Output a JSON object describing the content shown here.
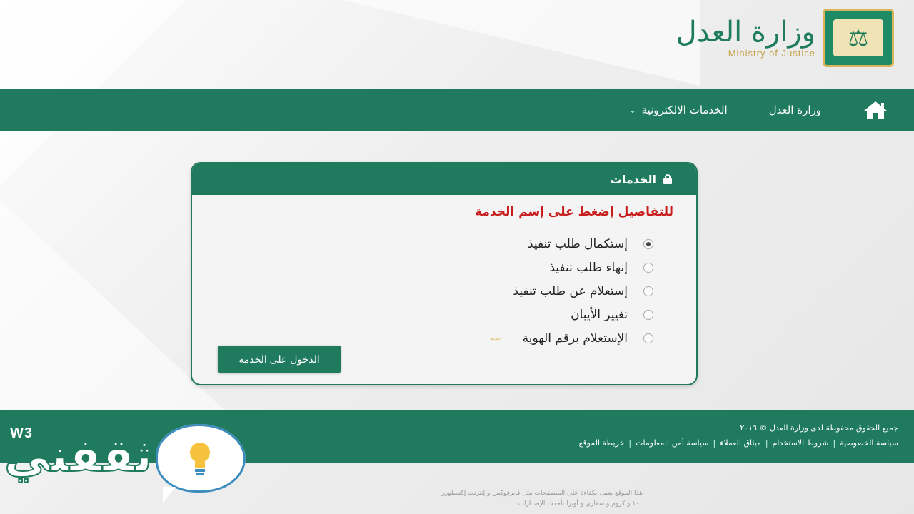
{
  "logo": {
    "arabic": "وزارة العدل",
    "english": "Ministry of Justice"
  },
  "nav": {
    "items": [
      {
        "label": "الخدمات الالكترونية",
        "has_dropdown": true
      },
      {
        "label": "وزارة العدل"
      }
    ],
    "home_icon": "home-icon"
  },
  "panel": {
    "title": "الخدمات",
    "instruction": "للتفاصيل إضغط على إسم الخدمة",
    "options": [
      {
        "label": "إستكمال طلب تنفيذ",
        "selected": true
      },
      {
        "label": "إنهاء طلب تنفيذ",
        "selected": false
      },
      {
        "label": "إستعلام عن طلب تنفيذ",
        "selected": false
      },
      {
        "label": "تغيير الأيبان",
        "selected": false
      },
      {
        "label": "الإستعلام برقم الهوية",
        "selected": false,
        "badge": "جديد"
      }
    ],
    "submit_label": "الدخول على الخدمة"
  },
  "footer": {
    "copyright": "جميع الحقوق محفوظة لدى وزارة العدل © ٢٠١٦",
    "links": [
      "سياسة الخصوصية",
      "شروط الاستخدام",
      "ميثاق العملاء",
      "سياسة أمن المعلومات",
      "خريطة الموقع"
    ],
    "bottom_note_1": "هذا الموقع يعمل بكفاءة على المتصفحات مثل فايرفوكس و إنترنت إكسبلورر",
    "bottom_note_2": "١٠٠ و كروم و سفاري و أوبرا بأحدث الإصدارات"
  },
  "watermark": {
    "text": "ثقفني",
    "badge": "W3"
  },
  "colors": {
    "primary": "#1f7a5e",
    "accent_gold": "#d9b45a",
    "alert_red": "#c81e1e"
  }
}
